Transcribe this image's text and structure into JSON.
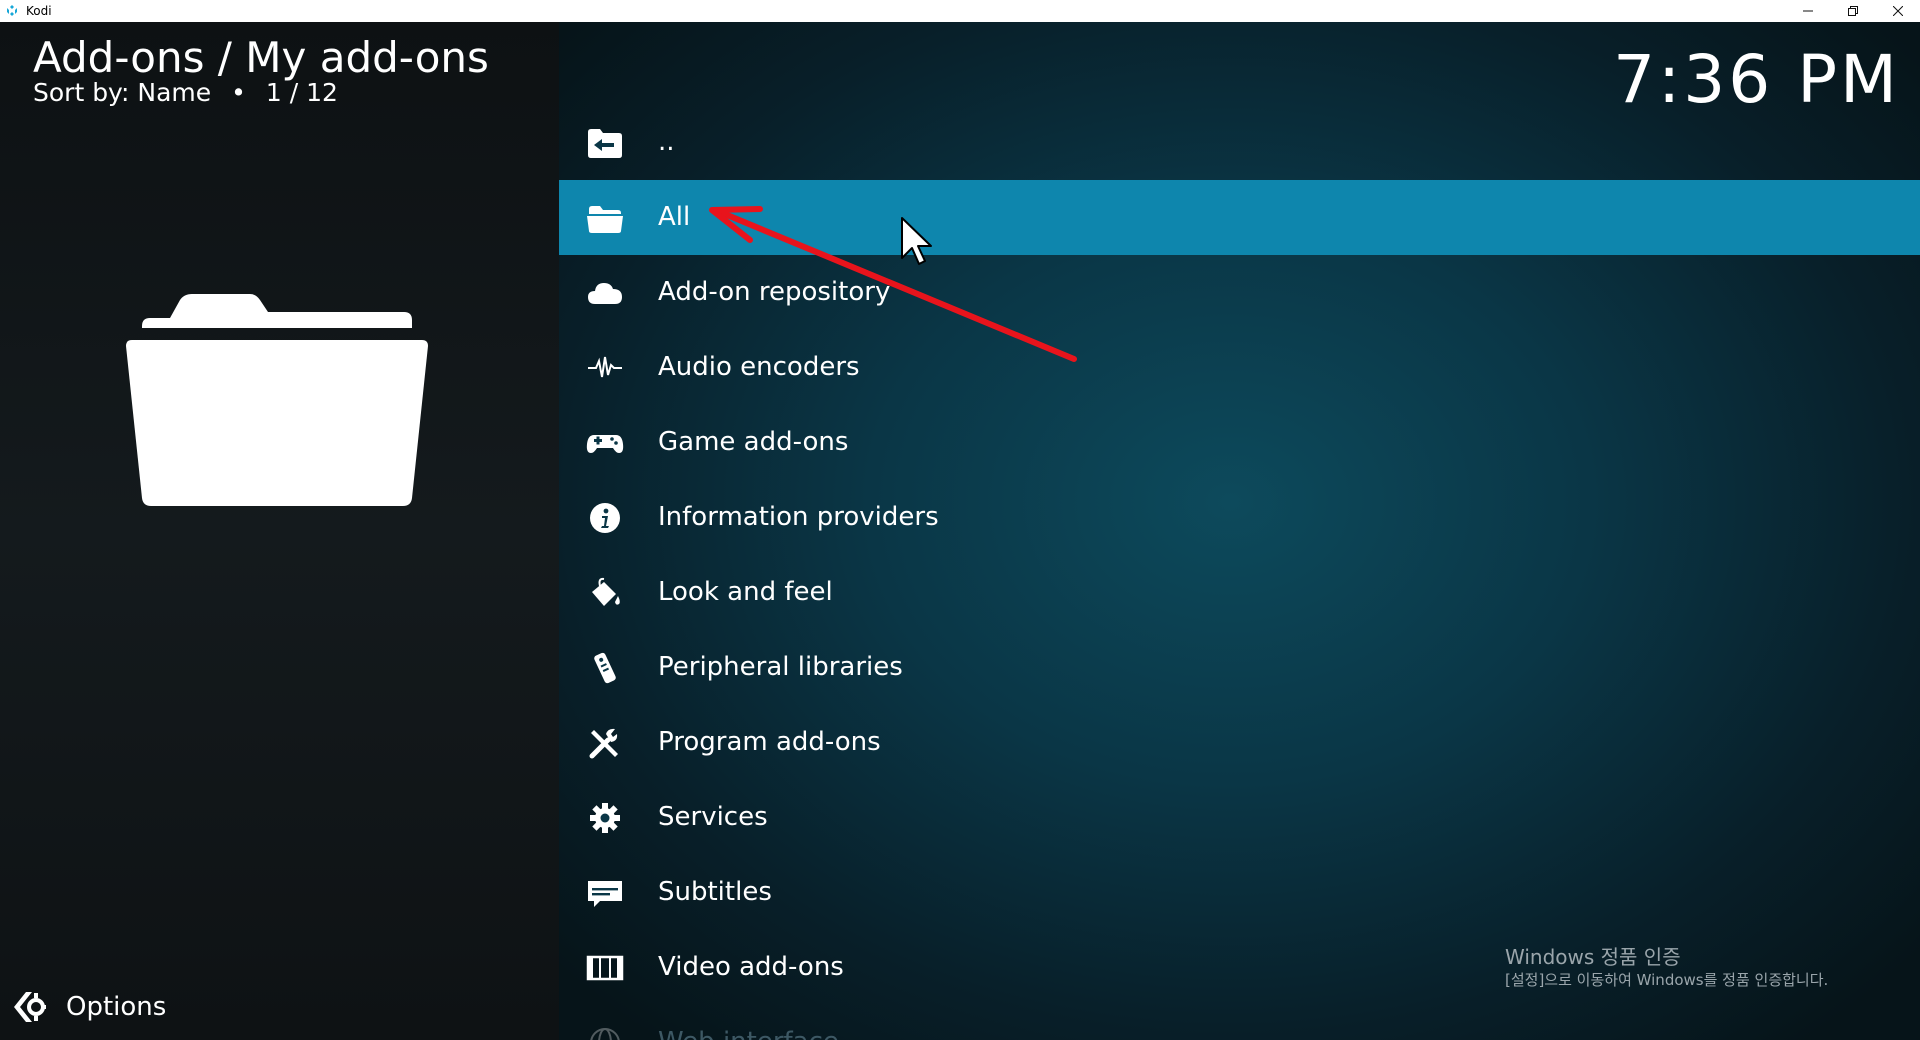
{
  "window": {
    "title": "Kodi",
    "controls": [
      "minimize",
      "restore",
      "close"
    ]
  },
  "header": {
    "title": "Add-ons / My add-ons",
    "sort_label": "Sort by: Name",
    "separator": "•",
    "position": "1 / 12"
  },
  "clock": "7:36 PM",
  "preview": {
    "icon": "folder-icon"
  },
  "options": {
    "label": "Options",
    "icon": "options-icon"
  },
  "list": {
    "items": [
      {
        "label": "..",
        "icon": "back-folder-icon",
        "selected": false
      },
      {
        "label": "All",
        "icon": "folder-icon",
        "selected": true
      },
      {
        "label": "Add-on repository",
        "icon": "cloud-icon",
        "selected": false
      },
      {
        "label": "Audio encoders",
        "icon": "waveform-icon",
        "selected": false
      },
      {
        "label": "Game add-ons",
        "icon": "gamepad-icon",
        "selected": false
      },
      {
        "label": "Information providers",
        "icon": "info-icon",
        "selected": false
      },
      {
        "label": "Look and feel",
        "icon": "paint-bucket-icon",
        "selected": false
      },
      {
        "label": "Peripheral libraries",
        "icon": "remote-icon",
        "selected": false
      },
      {
        "label": "Program add-ons",
        "icon": "tools-icon",
        "selected": false
      },
      {
        "label": "Services",
        "icon": "gear-icon",
        "selected": false
      },
      {
        "label": "Subtitles",
        "icon": "subtitles-icon",
        "selected": false
      },
      {
        "label": "Video add-ons",
        "icon": "film-icon",
        "selected": false
      },
      {
        "label": "Web interface",
        "icon": "globe-icon",
        "selected": false
      }
    ]
  },
  "watermark": {
    "line1": "Windows 정품 인증",
    "line2": "[설정]으로 이동하여 Windows를 정품 인증합니다."
  },
  "colors": {
    "selection": "#0e86ad",
    "annotation_arrow": "#e8141c",
    "background": "#0a3646"
  }
}
